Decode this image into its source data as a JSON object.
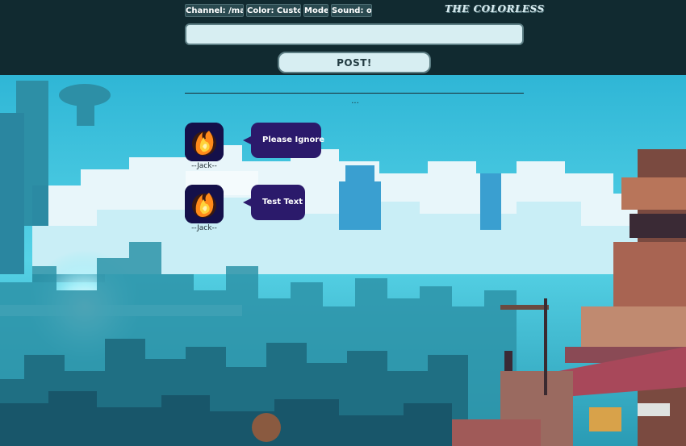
{
  "toolbar": {
    "channel_label": "Channel: /main/",
    "color_label": "Color: Custom",
    "mode_label": "Mode",
    "sound_label": "Sound: on"
  },
  "logo": {
    "text": "THE COLORLESS"
  },
  "composer": {
    "input_value": "",
    "input_placeholder": "",
    "post_label": "POST!"
  },
  "feed": {
    "load_more": "...",
    "posts": [
      {
        "username": "--Jack--",
        "message": "Please Ignore"
      },
      {
        "username": "--Jack--",
        "message": "Test Text"
      }
    ]
  },
  "colors": {
    "topbar": "#112a30",
    "bubble": "#2b1a6b",
    "sky": "#3ec6e0",
    "cloud": "#e8f6fa",
    "accent": "#ffd23a"
  }
}
